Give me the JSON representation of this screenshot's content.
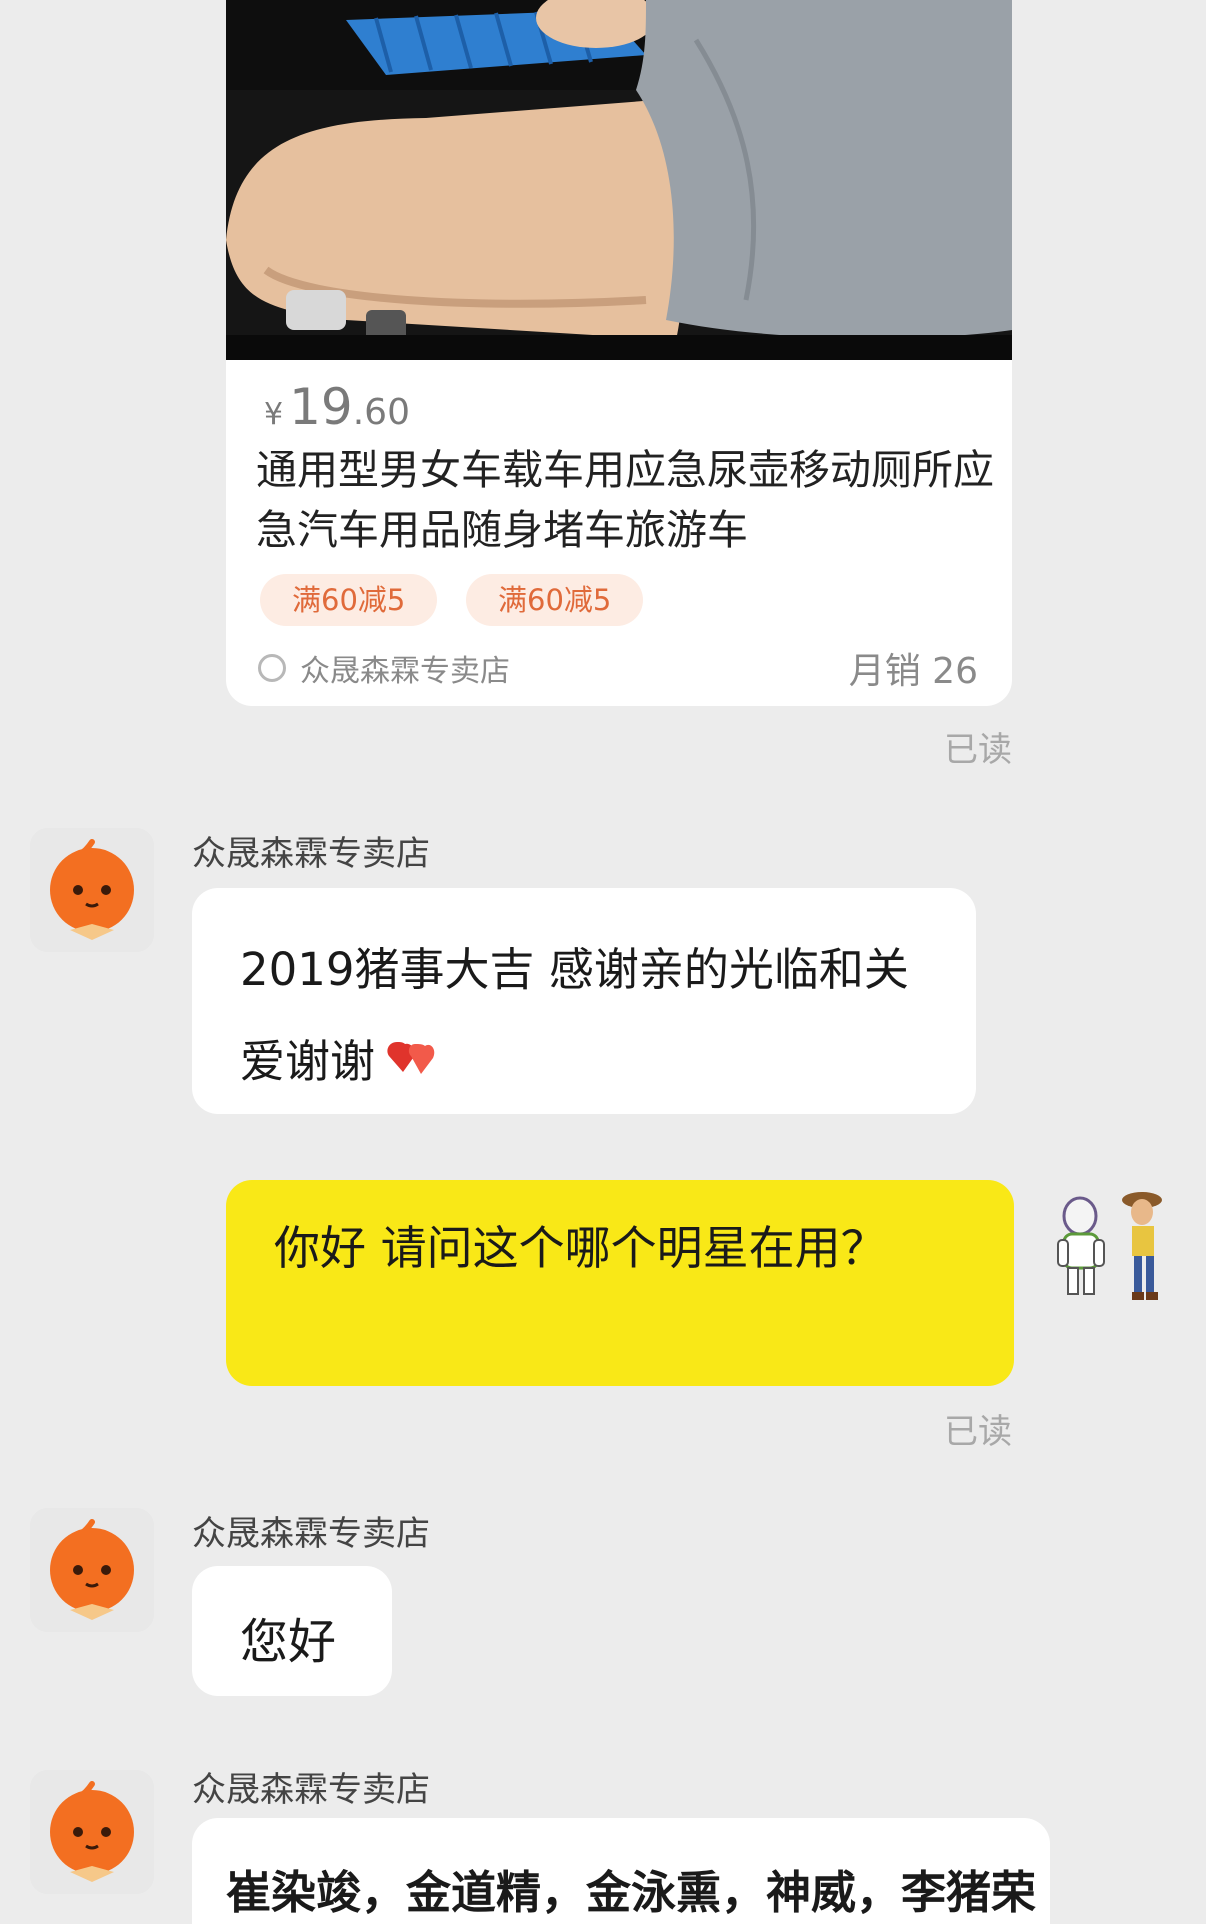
{
  "product": {
    "price_symbol": "¥",
    "price_main": "19",
    "price_cents": ".60",
    "title": "通用型男女车载车用应急尿壶移动厕所应急汽车用品随身堵车旅游车",
    "coupons": [
      "满60减5",
      "满60减5"
    ],
    "shop_name": "众晟森霖专卖店",
    "sales": "月销 26"
  },
  "read_label_1": "已读",
  "read_label_2": "已读",
  "messages": [
    {
      "sender": "众晟森霖专卖店",
      "text": "2019猪事大吉  感谢亲的光临和关爱谢谢"
    },
    {
      "sender": "me",
      "text": "你好 请问这个哪个明星在用？"
    },
    {
      "sender": "众晟森霖专卖店",
      "text": "您好"
    },
    {
      "sender": "众晟森霖专卖店",
      "text": "崔染竣，金道精，金泳熏，神威，李猪荣"
    }
  ],
  "colors": {
    "background": "#ececec",
    "user_bubble": "#f9e817",
    "shop_bubble": "#ffffff",
    "coupon_text": "#e06a3a",
    "avatar_orange": "#f36f21"
  },
  "icons": {
    "shop_avatar": "orange-mascot-icon",
    "user_avatar": "cartoon-characters-icon",
    "heart": "hearts-emoji-icon",
    "shop": "shop-circle-icon"
  }
}
